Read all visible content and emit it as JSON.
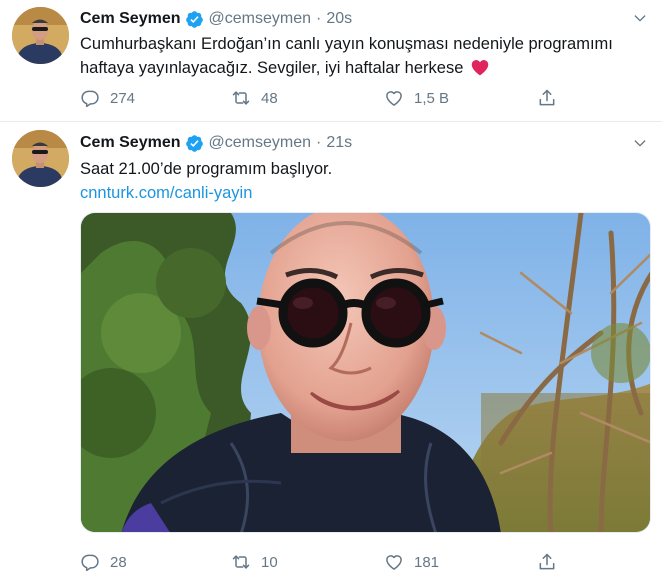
{
  "tweets": [
    {
      "name": "Cem Seymen",
      "handle": "@cemseymen",
      "separator": "·",
      "time": "20s",
      "text": "Cumhurbaşkanı Erdoğan’ın canlı yayın konuşması nedeniyle programımı haftaya yayınlayacağız. Sevgiler, iyi haftalar herkese",
      "emoji": "red-heart",
      "replies": "274",
      "retweets": "48",
      "likes": "1,5 B"
    },
    {
      "name": "Cem Seymen",
      "handle": "@cemseymen",
      "separator": "·",
      "time": "21s",
      "text": "Saat 21.00’de programım başlıyor.",
      "link": "cnnturk.com/canli-yayin",
      "replies": "28",
      "retweets": "10",
      "likes": "181",
      "image": "selfie-with-round-sunglasses-in-forest"
    }
  ],
  "colors": {
    "name": "#14171a",
    "muted": "#657786",
    "link": "#1b95e0",
    "verified": "#1da1f2",
    "heart": "#e0245e",
    "divider": "#e6ecf0"
  },
  "icons": [
    "verified-badge-icon",
    "caret-down-icon",
    "reply-icon",
    "retweet-icon",
    "like-icon",
    "share-icon"
  ]
}
